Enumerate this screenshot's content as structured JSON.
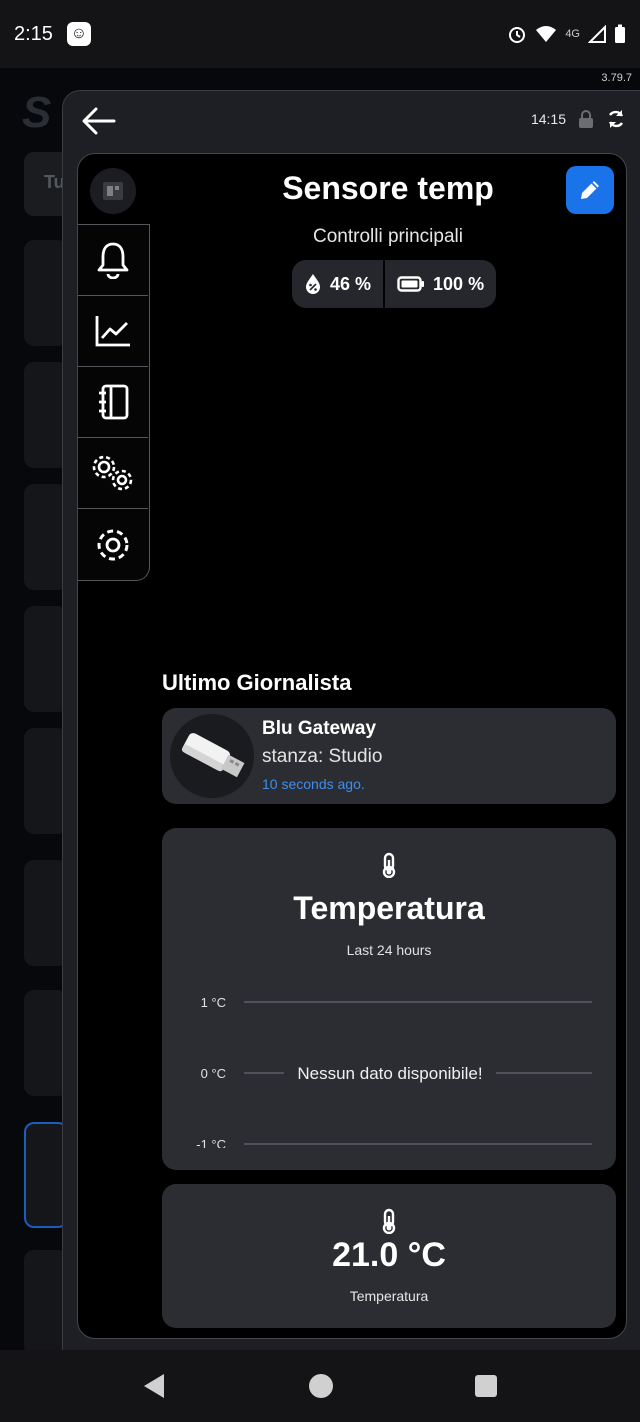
{
  "status_bar": {
    "time": "2:15",
    "network": "4G"
  },
  "version": "3.79.7",
  "background": {
    "logo": "S",
    "tab_label": "Tu"
  },
  "modal": {
    "time": "14:15"
  },
  "device": {
    "title": "Sensore temp",
    "subtitle": "Controlli principali",
    "humidity": "46 %",
    "battery": "100 %"
  },
  "reporter_section": {
    "title": "Ultimo Giornalista",
    "name": "Blu Gateway",
    "room": "stanza: Studio",
    "time": "10 seconds ago."
  },
  "chart_data": {
    "type": "line",
    "title": "Temperatura",
    "subtitle": "Last 24 hours",
    "y_ticks": [
      "1 °C",
      "0 °C",
      "-1 °C"
    ],
    "ylim": [
      -1,
      1
    ],
    "series": [],
    "empty_message": "Nessun dato disponibile!",
    "grid": true
  },
  "value_card": {
    "value": "21.0 °C",
    "label": "Temperatura"
  },
  "colors": {
    "accent": "#1a73e8",
    "link": "#3d8ef0",
    "card": "#2c2d32",
    "panel": "#000000"
  }
}
